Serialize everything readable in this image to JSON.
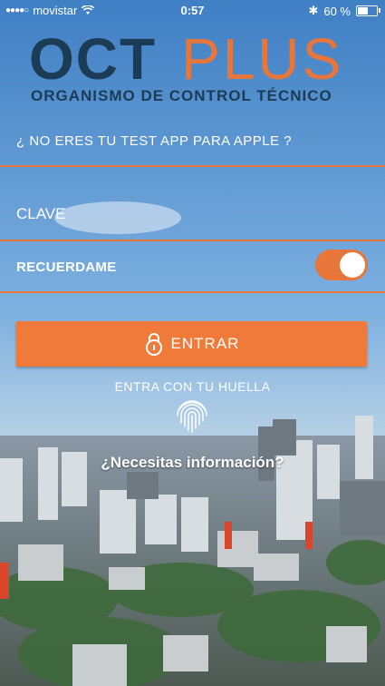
{
  "status_bar": {
    "carrier": "movistar",
    "time": "0:57",
    "battery": "60 %"
  },
  "logo": {
    "brand_part1": "OCT",
    "brand_part2": "PLUS",
    "subtitle": "ORGANISMO DE CONTROL TÉCNICO"
  },
  "login": {
    "not_you_link": "¿ NO ERES TU TEST APP PARA APPLE ?",
    "password_placeholder": "CLAVE",
    "remember_label": "RECUERDAME",
    "remember_on": true,
    "submit_label": "ENTRAR",
    "fingerprint_label": "ENTRA CON TU HUELLA",
    "info_link": "¿Necesitas información?"
  },
  "colors": {
    "accent": "#ef7a3a",
    "brand_dark": "#1c3c56"
  }
}
